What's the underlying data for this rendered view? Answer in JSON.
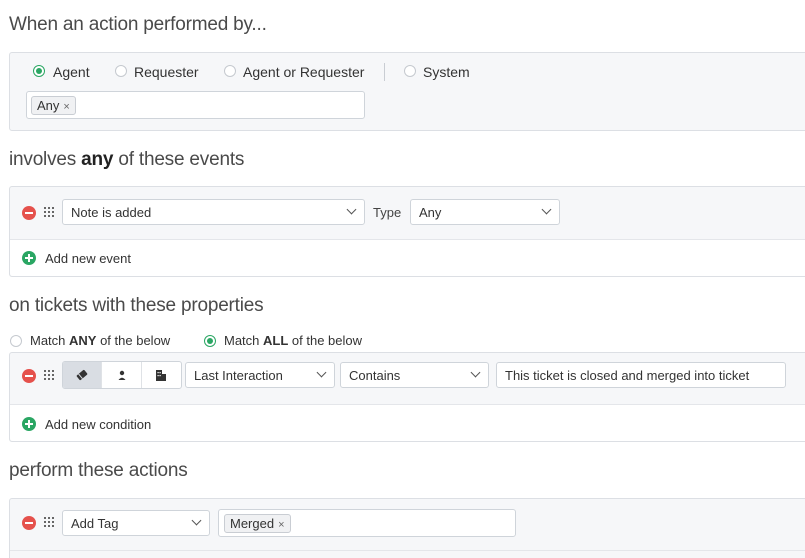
{
  "section_actor": {
    "heading": "When an action performed by...",
    "options": [
      {
        "label": "Agent",
        "selected": true
      },
      {
        "label": "Requester",
        "selected": false
      },
      {
        "label": "Agent or Requester",
        "selected": false
      },
      {
        "label": "System",
        "selected": false
      }
    ],
    "tags": [
      "Any"
    ],
    "tag_remove": "×"
  },
  "section_events": {
    "heading_pre": "involves ",
    "heading_bold": "any",
    "heading_post": " of these events",
    "event_value": "Note is added",
    "type_label": "Type",
    "type_value": "Any",
    "add_label": "Add new event"
  },
  "section_conditions": {
    "heading": "on tickets with these properties",
    "match_any": {
      "pre": "Match ",
      "bold": "ANY",
      "post": " of the below",
      "selected": false
    },
    "match_all": {
      "pre": "Match ",
      "bold": "ALL",
      "post": " of the below",
      "selected": true
    },
    "segments": [
      {
        "icon": "ticket-icon",
        "selected": true
      },
      {
        "icon": "person-icon",
        "selected": false
      },
      {
        "icon": "building-icon",
        "selected": false
      }
    ],
    "field_value": "Last Interaction",
    "operator_value": "Contains",
    "text_value": "This ticket is closed and merged into ticket",
    "add_label": "Add new condition"
  },
  "section_actions": {
    "heading": "perform these actions",
    "action_value": "Add Tag",
    "tags": [
      "Merged"
    ],
    "tag_remove": "×"
  },
  "colors": {
    "accent_green": "#2aa663",
    "remove_red": "#e5514c",
    "panel_bg": "#f6f7f9",
    "border": "#dcdfe4"
  }
}
